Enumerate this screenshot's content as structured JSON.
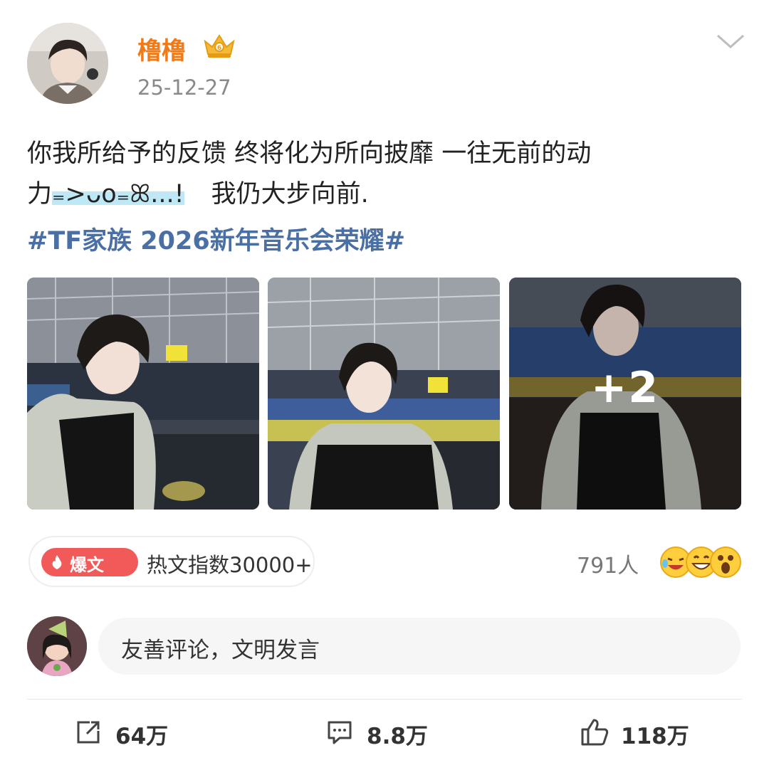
{
  "post": {
    "username": "橹橹",
    "date": "25-12-27",
    "text_line1": "你我所给予的反馈  终将化为所向披靡 一往无前的动",
    "text_line2_prefix": "力",
    "text_emote": "₌>ᴗo₌ꕤ...!",
    "text_line2_suffix": "我仍大步向前.",
    "hashtag": "#TF家族 2026新年音乐会荣耀#",
    "more_images": "+2"
  },
  "hot": {
    "badge_label": "爆文",
    "text": "热文指数30000+"
  },
  "reactions": {
    "count_text": "791人",
    "emoji_icons": [
      "laughing-tears-icon",
      "grinning-icon",
      "surprised-icon"
    ]
  },
  "comment": {
    "placeholder": "友善评论，文明发言"
  },
  "actions": {
    "share": "64万",
    "comments": "8.8万",
    "likes": "118万"
  },
  "colors": {
    "username": "#f07a16",
    "hashtag": "#4a6fa5",
    "hot_badge": "#f25a5a",
    "emote_highlight": "#bfe8f6"
  }
}
